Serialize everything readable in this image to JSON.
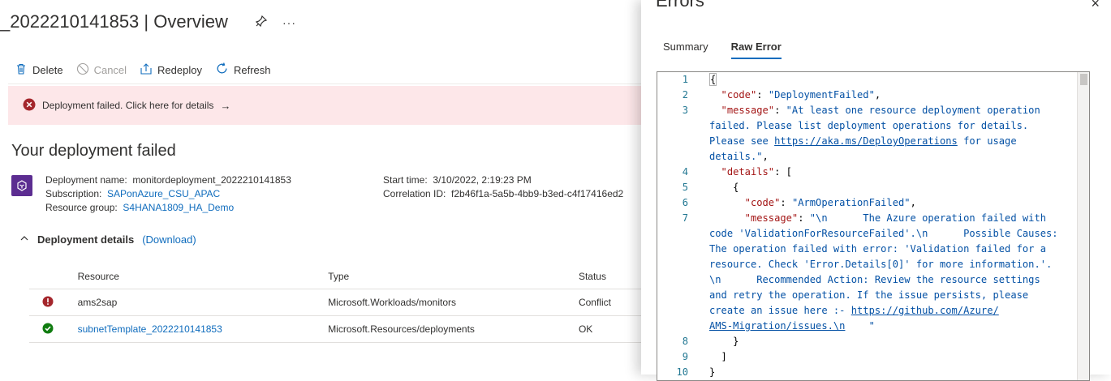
{
  "page": {
    "title": "_2022210141853 | Overview",
    "pin_icon": "pin-icon",
    "more_icon": "ellipsis-icon",
    "more_label": "···"
  },
  "toolbar": {
    "delete_label": "Delete",
    "cancel_label": "Cancel",
    "redeploy_label": "Redeploy",
    "refresh_label": "Refresh"
  },
  "banner": {
    "text": "Deployment failed. Click here for details",
    "arrow": "→"
  },
  "summary": {
    "heading": "Your deployment failed",
    "deployment_name_label": "Deployment name:",
    "deployment_name_value": "monitordeployment_2022210141853",
    "subscription_label": "Subscription:",
    "subscription_value": "SAPonAzure_CSU_APAC",
    "resource_group_label": "Resource group:",
    "resource_group_value": "S4HANA1809_HA_Demo",
    "start_time_label": "Start time:",
    "start_time_value": "3/10/2022, 2:19:23 PM",
    "correlation_label": "Correlation ID:",
    "correlation_value": "f2b46f1a-5a5b-4bb9-b3ed-c4f17416ed2"
  },
  "details": {
    "label": "Deployment details",
    "download_label": "(Download)",
    "columns": [
      "Resource",
      "Type",
      "Status"
    ],
    "rows": [
      {
        "resource": "ams2sap",
        "type": "Microsoft.Workloads/monitors",
        "status": "Conflict",
        "status_icon": "error-icon",
        "link": false
      },
      {
        "resource": "subnetTemplate_2022210141853",
        "type": "Microsoft.Resources/deployments",
        "status": "OK",
        "status_icon": "success-icon",
        "link": true
      }
    ]
  },
  "errors_panel": {
    "title": "Errors",
    "close_label": "×",
    "tabs": [
      "Summary",
      "Raw Error"
    ],
    "active_tab": "Raw Error",
    "lines": [
      {
        "n": "1",
        "html": [
          {
            "t": "{",
            "c": "pun"
          }
        ]
      },
      {
        "n": "2",
        "html": [
          {
            "t": "  \"code\"",
            "c": "key"
          },
          {
            "t": ": ",
            "c": "pun"
          },
          {
            "t": "\"DeploymentFailed\"",
            "c": "str"
          },
          {
            "t": ",",
            "c": "pun"
          }
        ]
      },
      {
        "n": "3",
        "html": [
          {
            "t": "  \"message\"",
            "c": "key"
          },
          {
            "t": ": ",
            "c": "pun"
          },
          {
            "t": "\"At least one resource deployment operation",
            "c": "str"
          }
        ]
      },
      {
        "n": "",
        "html": [
          {
            "t": "failed. Please list deployment operations for details.",
            "c": "str"
          }
        ]
      },
      {
        "n": "",
        "html": [
          {
            "t": "Please see ",
            "c": "str"
          },
          {
            "t": "https://aka.ms/DeployOperations",
            "c": "url"
          },
          {
            "t": " for usage",
            "c": "str"
          }
        ]
      },
      {
        "n": "",
        "html": [
          {
            "t": "details.\"",
            "c": "str"
          },
          {
            "t": ",",
            "c": "pun"
          }
        ]
      },
      {
        "n": "4",
        "html": [
          {
            "t": "  \"details\"",
            "c": "key"
          },
          {
            "t": ": [",
            "c": "pun"
          }
        ]
      },
      {
        "n": "5",
        "html": [
          {
            "t": "    {",
            "c": "pun"
          }
        ]
      },
      {
        "n": "6",
        "html": [
          {
            "t": "      \"code\"",
            "c": "key"
          },
          {
            "t": ": ",
            "c": "pun"
          },
          {
            "t": "\"ArmOperationFailed\"",
            "c": "str"
          },
          {
            "t": ",",
            "c": "pun"
          }
        ]
      },
      {
        "n": "7",
        "html": [
          {
            "t": "      \"message\"",
            "c": "key"
          },
          {
            "t": ": ",
            "c": "pun"
          },
          {
            "t": "\"\\n      The Azure operation failed with",
            "c": "str"
          }
        ]
      },
      {
        "n": "",
        "html": [
          {
            "t": "code 'ValidationForResourceFailed'.\\n      Possible Causes:",
            "c": "str"
          }
        ]
      },
      {
        "n": "",
        "html": [
          {
            "t": "The operation failed with error: 'Validation failed for a",
            "c": "str"
          }
        ]
      },
      {
        "n": "",
        "html": [
          {
            "t": "resource. Check 'Error.Details[0]' for more information.'.",
            "c": "str"
          }
        ]
      },
      {
        "n": "",
        "html": [
          {
            "t": "\\n      Recommended Action: Review the resource settings",
            "c": "str"
          }
        ]
      },
      {
        "n": "",
        "html": [
          {
            "t": "and retry the operation. If the issue persists, please",
            "c": "str"
          }
        ]
      },
      {
        "n": "",
        "html": [
          {
            "t": "create an issue here :- ",
            "c": "str"
          },
          {
            "t": "https://github.com/Azure/",
            "c": "url"
          }
        ]
      },
      {
        "n": "",
        "html": [
          {
            "t": "AMS-Migration/issues.\\n",
            "c": "url"
          },
          {
            "t": "    \"",
            "c": "str"
          }
        ]
      },
      {
        "n": "8",
        "html": [
          {
            "t": "    }",
            "c": "pun"
          }
        ]
      },
      {
        "n": "9",
        "html": [
          {
            "t": "  ]",
            "c": "pun"
          }
        ]
      },
      {
        "n": "10",
        "html": [
          {
            "t": "}",
            "c": "pun"
          }
        ]
      }
    ]
  },
  "colors": {
    "accent": "#0f6cbd",
    "error": "#a4262c",
    "success": "#107c10",
    "banner_bg": "#fde7e9"
  }
}
